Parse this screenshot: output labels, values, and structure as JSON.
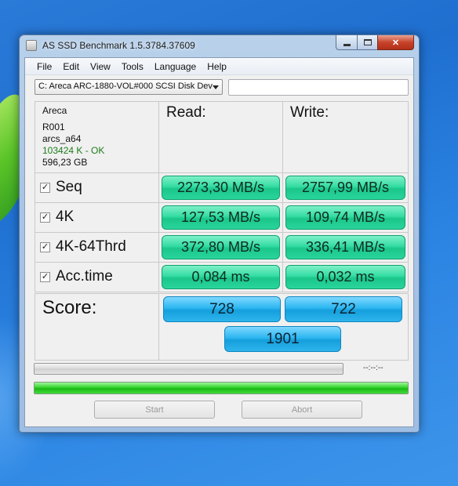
{
  "window": {
    "title": "AS SSD Benchmark 1.5.3784.37609"
  },
  "menu": {
    "items": [
      "File",
      "Edit",
      "View",
      "Tools",
      "Language",
      "Help"
    ]
  },
  "drive": {
    "selected": "C: Areca ARC-1880-VOL#000 SCSI Disk Dev",
    "text_field": ""
  },
  "info": {
    "vendor": "Areca",
    "firmware": "R001",
    "driver": "arcs_a64",
    "alignment": "103424 K - OK",
    "size": "596,23 GB"
  },
  "headers": {
    "read": "Read:",
    "write": "Write:"
  },
  "tests": [
    {
      "label": "Seq",
      "checked": true,
      "read": "2273,30 MB/s",
      "write": "2757,99 MB/s"
    },
    {
      "label": "4K",
      "checked": true,
      "read": "127,53 MB/s",
      "write": "109,74 MB/s"
    },
    {
      "label": "4K-64Thrd",
      "checked": true,
      "read": "372,80 MB/s",
      "write": "336,41 MB/s"
    },
    {
      "label": "Acc.time",
      "checked": true,
      "read": "0,084 ms",
      "write": "0,032 ms"
    }
  ],
  "score": {
    "label": "Score:",
    "read": "728",
    "write": "722",
    "total": "1901"
  },
  "status": {
    "time": "--:--:--",
    "progress_fraction": 1.0
  },
  "buttons": {
    "start": "Start",
    "abort": "Abort"
  },
  "colors": {
    "result_green": "#2ad59c",
    "score_blue": "#2bb6f0",
    "progress_green": "#36d52e",
    "alignment_ok": "#1c7c1c"
  }
}
